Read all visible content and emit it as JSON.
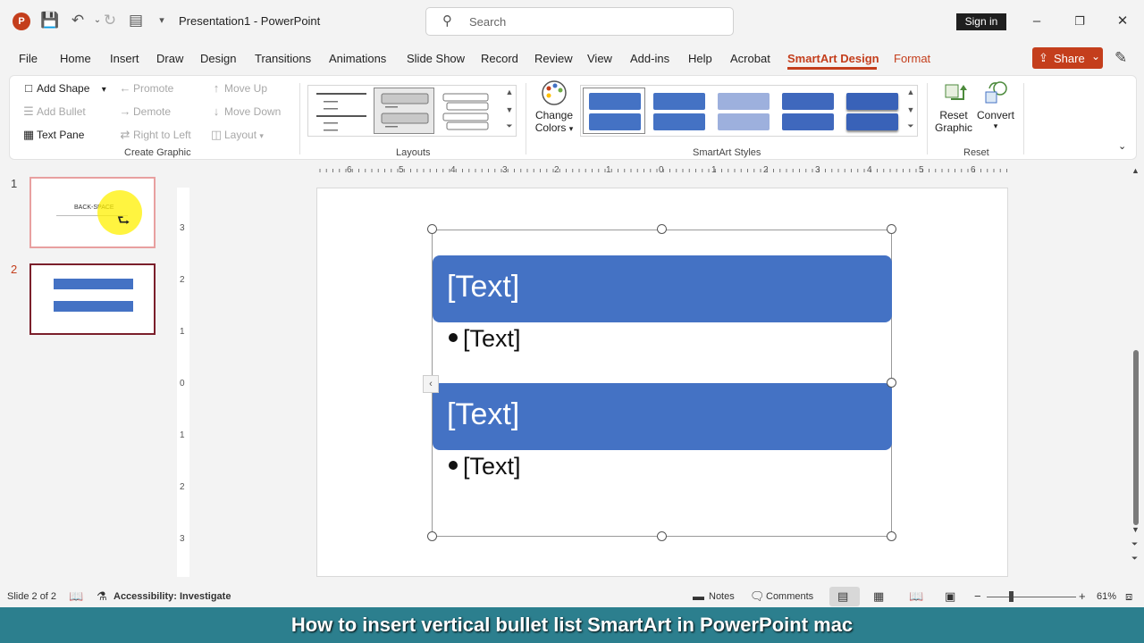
{
  "window": {
    "doc_title": "Presentation1",
    "app_name": "PowerPoint",
    "title_separator": " - ",
    "search_placeholder": "Search",
    "sign_in_label": "Sign in",
    "logo_letter": "P"
  },
  "menu": {
    "items": [
      "File",
      "Home",
      "Insert",
      "Draw",
      "Design",
      "Transitions",
      "Animations",
      "Slide Show",
      "Record",
      "Review",
      "View",
      "Add-ins",
      "Help",
      "Acrobat",
      "SmartArt Design",
      "Format"
    ],
    "active": "SmartArt Design",
    "share_label": "Share"
  },
  "ribbon": {
    "create_graphic": {
      "label": "Create Graphic",
      "add_shape": "Add Shape",
      "add_bullet": "Add Bullet",
      "text_pane": "Text Pane",
      "promote": "Promote",
      "demote": "Demote",
      "right_to_left": "Right to Left",
      "move_up": "Move Up",
      "move_down": "Move Down",
      "layout": "Layout"
    },
    "layouts": {
      "label": "Layouts"
    },
    "smartart_styles": {
      "label": "SmartArt Styles",
      "change_colors_line1": "Change",
      "change_colors_line2": "Colors"
    },
    "reset": {
      "label": "Reset",
      "reset_graphic_line1": "Reset",
      "reset_graphic_line2": "Graphic",
      "convert": "Convert"
    }
  },
  "slides": {
    "items": [
      {
        "number": "1",
        "thumb_text": "BACK-SPACE"
      },
      {
        "number": "2"
      }
    ],
    "active_index": 1
  },
  "ruler": {
    "horizontal": [
      "6",
      "5",
      "4",
      "3",
      "2",
      "1",
      "0",
      "1",
      "2",
      "3",
      "4",
      "5",
      "6"
    ],
    "vertical": [
      "3",
      "2",
      "1",
      "0",
      "1",
      "2",
      "3"
    ]
  },
  "smartart": {
    "blocks": [
      {
        "header": "[Text]",
        "bullet": "[Text]"
      },
      {
        "header": "[Text]",
        "bullet": "[Text]"
      }
    ],
    "fill_color": "#4472c4"
  },
  "status": {
    "slide_info": "Slide 2 of 2",
    "accessibility": "Accessibility: Investigate",
    "notes": "Notes",
    "comments": "Comments",
    "zoom_minus": "−",
    "zoom_plus": "+",
    "zoom": "61%"
  },
  "caption": "How to insert vertical bullet list SmartArt in PowerPoint mac",
  "colors": {
    "accent": "#c43e1c",
    "smartart_blue": "#4472c4",
    "caption_bg": "#2c7f8e"
  }
}
